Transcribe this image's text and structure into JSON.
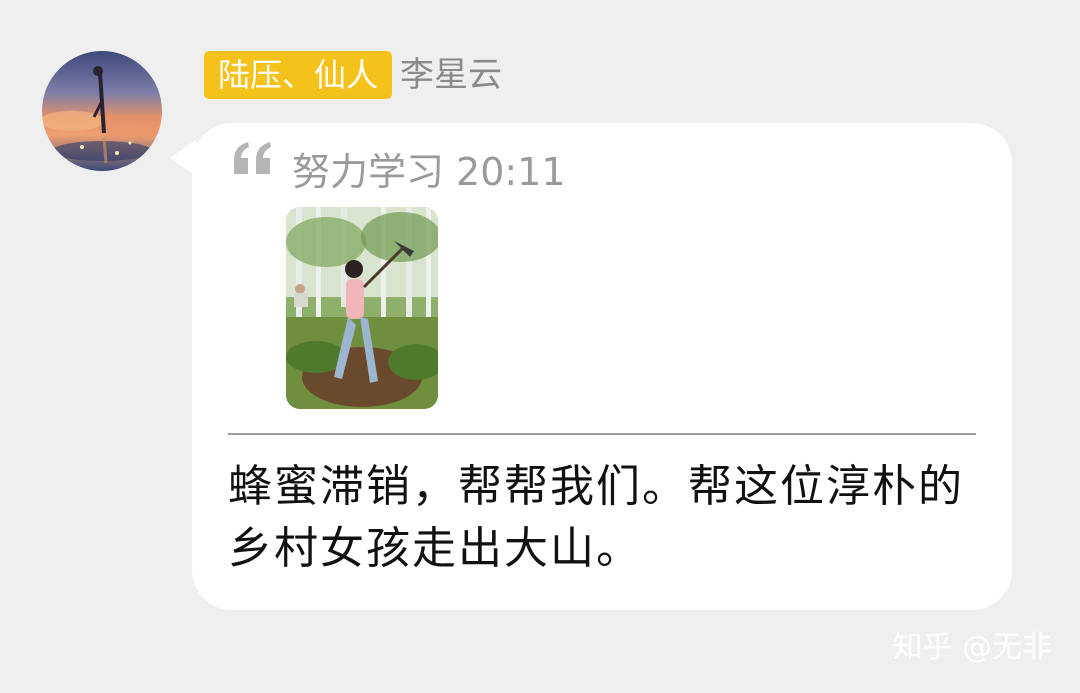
{
  "sender": {
    "title_badge": "陆压、仙人",
    "name": "李星云"
  },
  "quote": {
    "author": "努力学习",
    "time": "20:11"
  },
  "message": {
    "text": "蜂蜜滞销，帮帮我们。帮这位淳朴的乡村女孩走出大山。"
  },
  "watermark": "知乎 @无非",
  "colors": {
    "background": "#efefef",
    "bubble": "#ffffff",
    "badge": "#f5c21b",
    "muted_text": "#9a9a9a"
  },
  "icons": {
    "quote": "quote-icon"
  }
}
